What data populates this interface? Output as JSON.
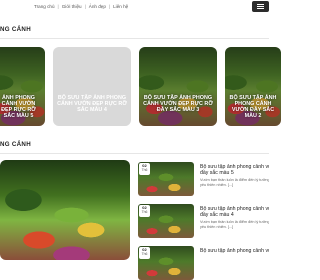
{
  "nav": {
    "items": [
      "Trang chủ",
      "Giới thiệu",
      "Ảnh đẹp",
      "Liên hệ"
    ]
  },
  "section1": {
    "title": "NG CẢNH"
  },
  "section2": {
    "title": "NG CẢNH"
  },
  "gallery": [
    {
      "caption": "ẢNH PHONG CẢNH VƯỜN ĐẸP RỰC RỠ SẮC MÀU 5",
      "sub": ""
    },
    {
      "caption": "BỘ SƯU TẬP ẢNH PHONG CẢNH VƯỜN ĐẸP RỰC RỠ SẮC MÀU 4",
      "sub": ""
    },
    {
      "caption": "BỘ SƯU TẬP ẢNH PHONG CẢNH VƯỜN ĐẸP RỰC RỠ ĐẦY SẮC MÀU 3",
      "sub": ""
    },
    {
      "caption": "BỘ SƯU TẬP ẢNH PHONG CẢNH VƯỜN ĐẦY SẮC MÀU 2",
      "sub": ""
    }
  ],
  "posts": [
    {
      "day": "02",
      "month": "Th6",
      "title_line1": "Bộ sưu tập ảnh phong cảnh vườn",
      "title_line2": "đầy sắc màu 5",
      "excerpt_line1": "Vườn bạn thân luôn là điểm đến lý tưởng cho những",
      "excerpt_line2": "yêu thiên nhiên. [...]"
    },
    {
      "day": "02",
      "month": "Th6",
      "title_line1": "Bộ sưu tập ảnh phong cảnh vườn",
      "title_line2": "đầy sắc màu 4",
      "excerpt_line1": "Vườn bạn thân luôn là điểm đến lý tưởng cho những",
      "excerpt_line2": "yêu thiên nhiên. [...]"
    },
    {
      "day": "02",
      "month": "Th6",
      "title_line1": "Bộ sưu tập ảnh phong cảnh vườn",
      "title_line2": "",
      "excerpt_line1": "",
      "excerpt_line2": ""
    }
  ]
}
